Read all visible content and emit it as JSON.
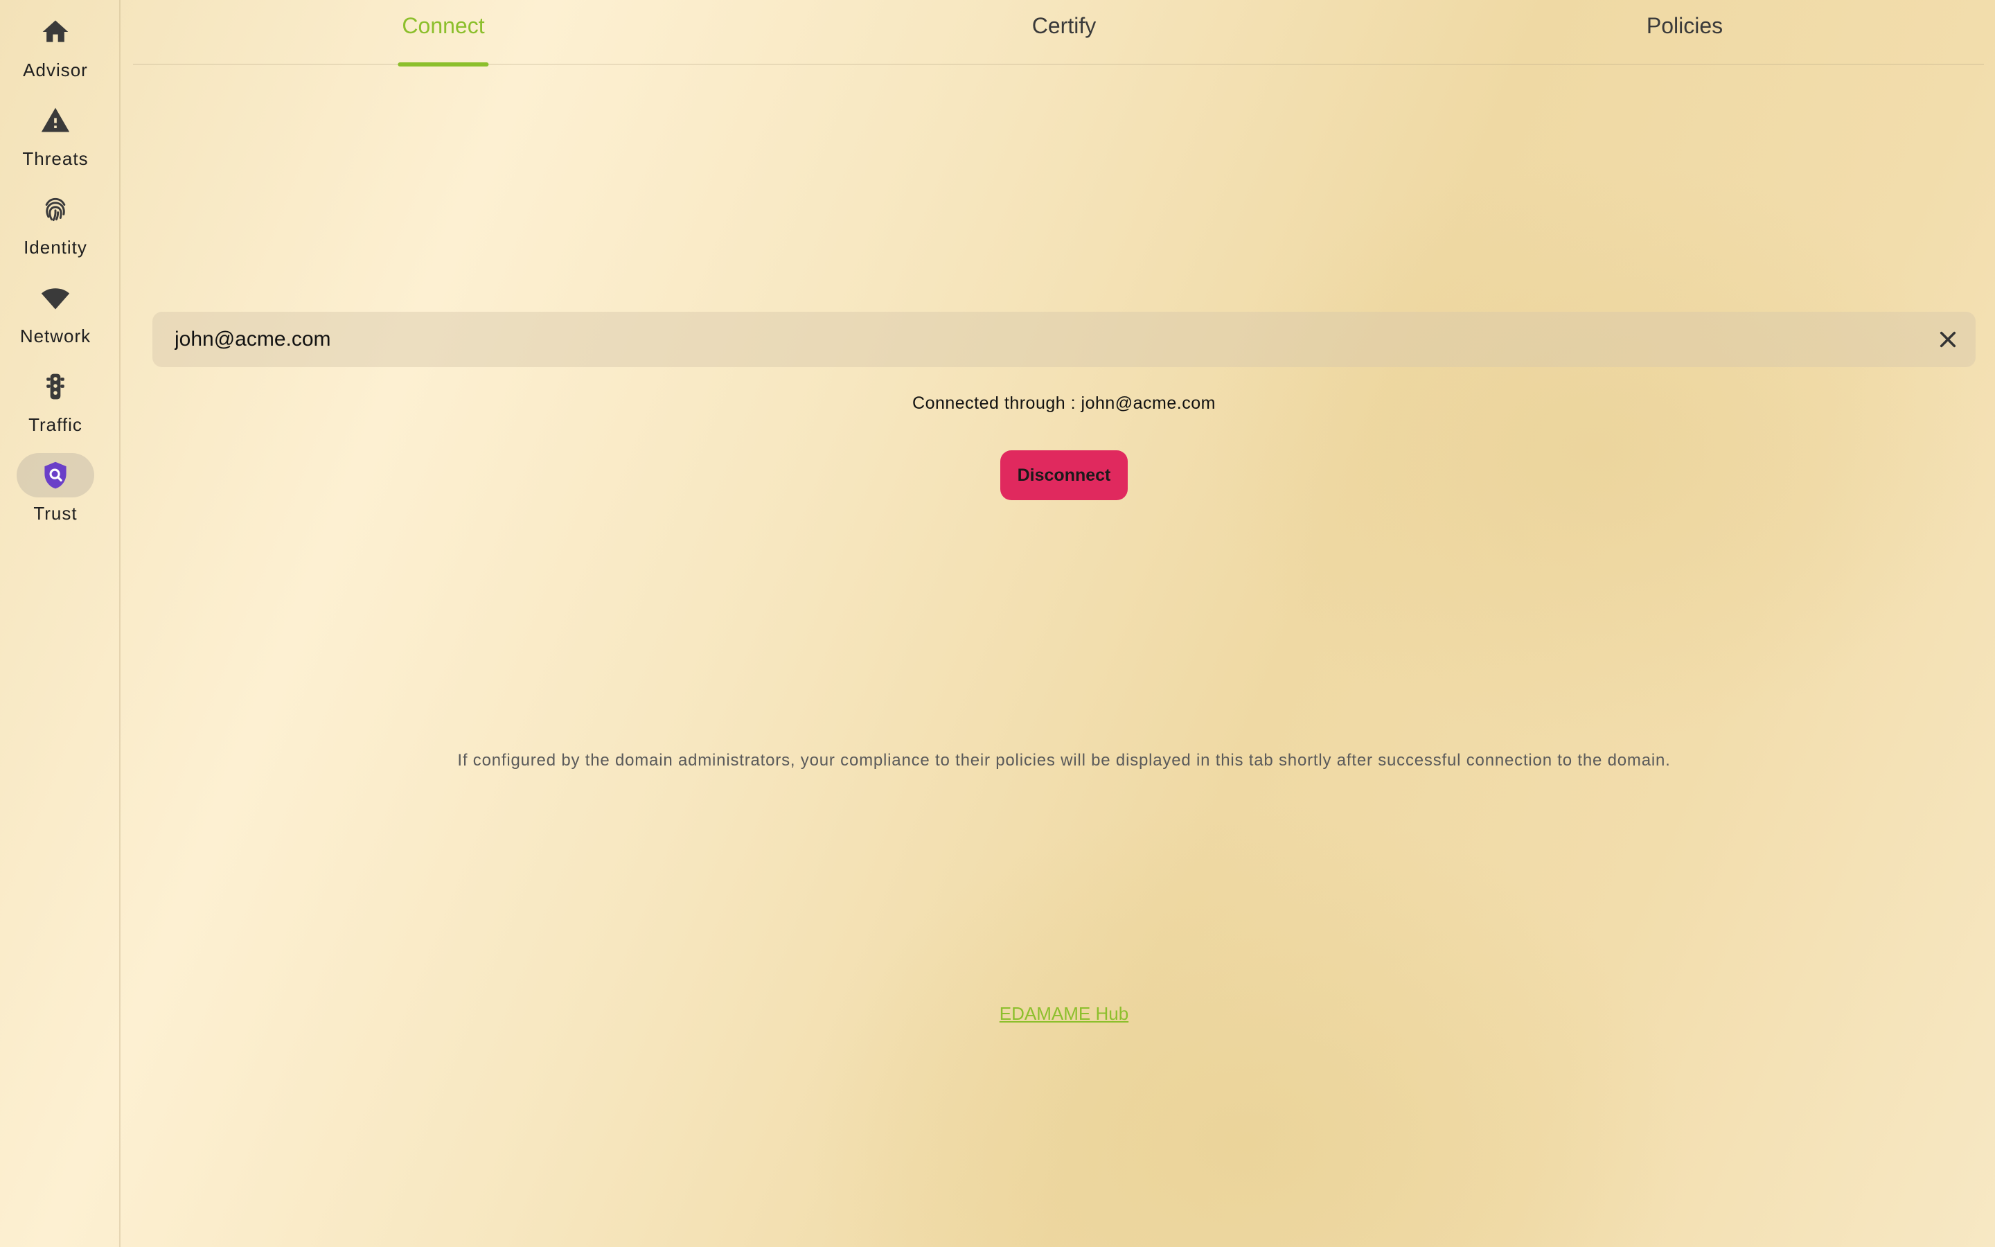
{
  "sidebar": {
    "items": [
      {
        "label": "Advisor",
        "icon": "home-icon"
      },
      {
        "label": "Threats",
        "icon": "warning-icon"
      },
      {
        "label": "Identity",
        "icon": "fingerprint-icon"
      },
      {
        "label": "Network",
        "icon": "wifi-icon"
      },
      {
        "label": "Traffic",
        "icon": "traffic-light-icon"
      },
      {
        "label": "Trust",
        "icon": "shield-search-icon",
        "active": true
      }
    ]
  },
  "tabs": [
    {
      "label": "Connect",
      "active": true
    },
    {
      "label": "Certify"
    },
    {
      "label": "Policies"
    }
  ],
  "connect": {
    "domain_value": "john@acme.com",
    "status_text": "Connected through : john@acme.com",
    "disconnect_label": "Disconnect",
    "info_text": "If configured by the domain administrators, your compliance to their policies will be displayed in this tab shortly after successful connection to the domain.",
    "hub_link_label": "EDAMAME Hub"
  },
  "colors": {
    "accent": "#8cbf2c",
    "danger": "#e0295e",
    "trust_icon": "#6a3fc8"
  }
}
